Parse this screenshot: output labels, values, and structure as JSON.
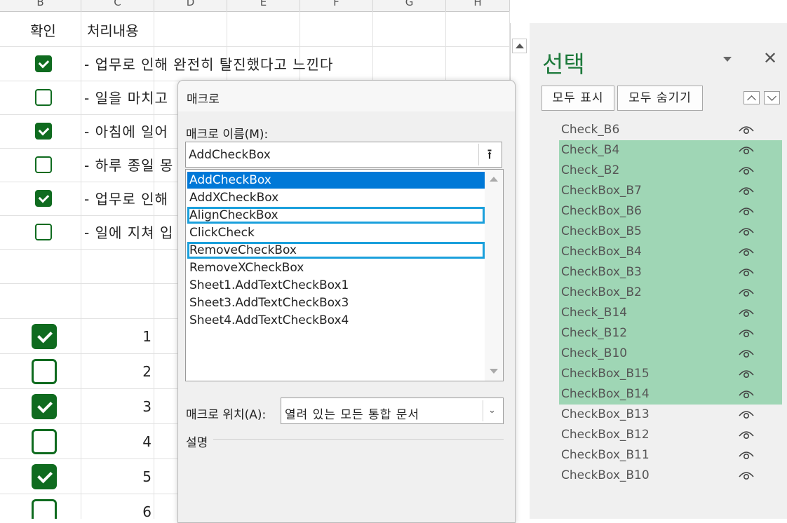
{
  "sheet": {
    "col_headers": [
      "B",
      "C",
      "D",
      "E",
      "F",
      "G",
      "H"
    ],
    "header_confirm": "확인",
    "header_content": "처리내용",
    "rows": [
      {
        "checked": true,
        "text": "- 업무로 인해 완전히 탈진했다고 느낀다"
      },
      {
        "checked": false,
        "text": "- 일을 마치고"
      },
      {
        "checked": true,
        "text": "- 아침에 일어"
      },
      {
        "checked": false,
        "text": "- 하루 종일 몽"
      },
      {
        "checked": true,
        "text": "- 업무로 인해"
      },
      {
        "checked": false,
        "text": "- 일에 지쳐 입"
      }
    ],
    "numbered": [
      {
        "checked": true,
        "num": "1"
      },
      {
        "checked": false,
        "num": "2"
      },
      {
        "checked": true,
        "num": "3"
      },
      {
        "checked": false,
        "num": "4"
      },
      {
        "checked": true,
        "num": "5"
      },
      {
        "checked": false,
        "num": "6"
      }
    ]
  },
  "dialog": {
    "title": "매크로",
    "name_label": "매크로 이름(M):",
    "name_value": "AddCheckBox",
    "macros": [
      {
        "label": "AddCheckBox",
        "selected": true,
        "highlighted": false
      },
      {
        "label": "AddXCheckBox",
        "selected": false,
        "highlighted": false
      },
      {
        "label": "AlignCheckBox",
        "selected": false,
        "highlighted": true
      },
      {
        "label": "ClickCheck",
        "selected": false,
        "highlighted": false
      },
      {
        "label": "RemoveCheckBox",
        "selected": false,
        "highlighted": true
      },
      {
        "label": "RemoveXCheckBox",
        "selected": false,
        "highlighted": false
      },
      {
        "label": "Sheet1.AddTextCheckBox1",
        "selected": false,
        "highlighted": false
      },
      {
        "label": "Sheet3.AddTextCheckBox3",
        "selected": false,
        "highlighted": false
      },
      {
        "label": "Sheet4.AddTextCheckBox4",
        "selected": false,
        "highlighted": false
      }
    ],
    "location_label": "매크로 위치(A):",
    "location_value": "열려 있는 모든 통합 문서",
    "description_label": "설명"
  },
  "pane": {
    "title": "선택",
    "show_all": "모두 표시",
    "hide_all": "모두 숨기기",
    "objects": [
      {
        "name": "Check_B6",
        "selected": false
      },
      {
        "name": "Check_B4",
        "selected": true
      },
      {
        "name": "Check_B2",
        "selected": true
      },
      {
        "name": "CheckBox_B7",
        "selected": true
      },
      {
        "name": "CheckBox_B6",
        "selected": true
      },
      {
        "name": "CheckBox_B5",
        "selected": true
      },
      {
        "name": "CheckBox_B4",
        "selected": true
      },
      {
        "name": "CheckBox_B3",
        "selected": true
      },
      {
        "name": "CheckBox_B2",
        "selected": true
      },
      {
        "name": "Check_B14",
        "selected": true
      },
      {
        "name": "Check_B12",
        "selected": true
      },
      {
        "name": "Check_B10",
        "selected": true
      },
      {
        "name": "CheckBox_B15",
        "selected": true
      },
      {
        "name": "CheckBox_B14",
        "selected": true
      },
      {
        "name": "CheckBox_B13",
        "selected": false
      },
      {
        "name": "CheckBox_B12",
        "selected": false
      },
      {
        "name": "CheckBox_B11",
        "selected": false
      },
      {
        "name": "CheckBox_B10",
        "selected": false
      }
    ]
  },
  "colors": {
    "accent": "#0f6b1f",
    "selection": "#0078d7",
    "pane_highlight": "#9fd6b5",
    "callout": "#1aa0dc"
  }
}
